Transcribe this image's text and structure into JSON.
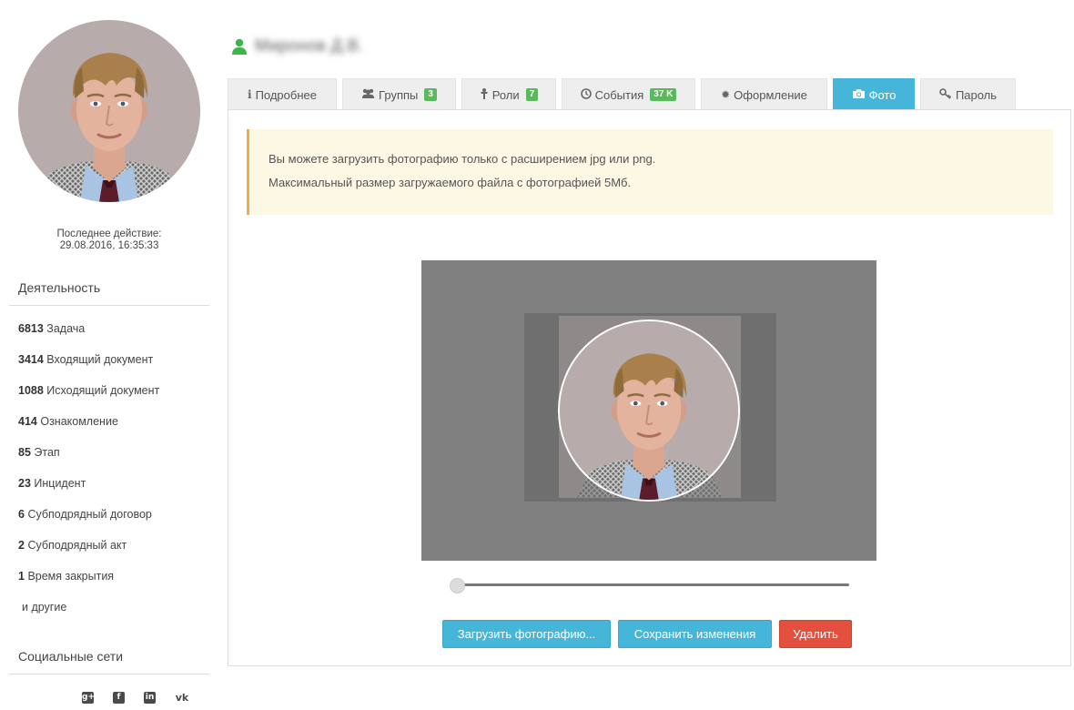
{
  "profile": {
    "user_name": "Миронов Д.В.",
    "last_action_label": "Последнее действие:",
    "last_action_time": "29.08.2016, 16:35:33"
  },
  "activity": {
    "title": "Деятельность",
    "items": [
      {
        "count": "6813",
        "label": "Задача"
      },
      {
        "count": "3414",
        "label": "Входящий документ"
      },
      {
        "count": "1088",
        "label": "Исходящий документ"
      },
      {
        "count": "414",
        "label": "Ознакомление"
      },
      {
        "count": "85",
        "label": "Этап"
      },
      {
        "count": "23",
        "label": "Инцидент"
      },
      {
        "count": "6",
        "label": "Субподрядный договор"
      },
      {
        "count": "2",
        "label": "Субподрядный акт"
      },
      {
        "count": "1",
        "label": "Время закрытия"
      }
    ],
    "more_label": "и другие"
  },
  "social": {
    "title": "Социальные сети",
    "icons": [
      "google-plus-icon",
      "facebook-icon",
      "linkedin-icon",
      "vk-icon"
    ]
  },
  "tabs": [
    {
      "icon": "info-icon",
      "label": "Подробнее",
      "badge": ""
    },
    {
      "icon": "users-icon",
      "label": "Группы",
      "badge": "3"
    },
    {
      "icon": "role-icon",
      "label": "Роли",
      "badge": "7"
    },
    {
      "icon": "clock-icon",
      "label": "События",
      "badge": "37 K"
    },
    {
      "icon": "gear-icon",
      "label": "Оформление",
      "badge": ""
    },
    {
      "icon": "camera-icon",
      "label": "Фото",
      "badge": ""
    },
    {
      "icon": "key-icon",
      "label": "Пароль",
      "badge": ""
    }
  ],
  "active_tab": "Фото",
  "photo_panel": {
    "notice_line1": "Вы можете загрузить фотографию только с расширением jpg или png.",
    "notice_line2": "Максимальный размер загружаемого файла с фотографией 5Мб.",
    "zoom_level": 0,
    "upload_button": "Загрузить фотографию...",
    "save_button": "Сохранить изменения",
    "delete_button": "Удалить"
  },
  "colors": {
    "accent": "#45b6d9",
    "badge": "#5cb85c",
    "danger": "#e3513e",
    "notice_bg": "#fcf8e3",
    "notice_border": "#f0ad4e",
    "user_icon": "#3cb64a"
  }
}
